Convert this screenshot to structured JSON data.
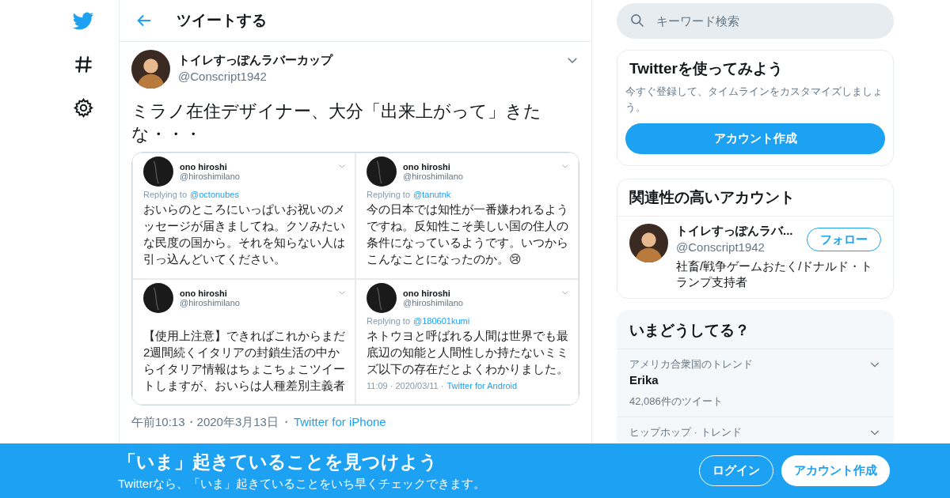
{
  "header": {
    "title": "ツイートする"
  },
  "tweet": {
    "author": {
      "name": "トイレすっぽんラバーカップ",
      "handle": "@Conscript1942"
    },
    "text": "ミラノ在住デザイナー、大分「出来上がって」きたな・・・",
    "embedded_screenshot": {
      "posts": [
        {
          "name": "ono hiroshi",
          "handle": "@hiroshimilano",
          "reply_prefix": "Replying to",
          "reply_to": "@octonubes",
          "text": "おいらのところにいっぱいお祝いのメッセージが届きましてね。クソみたいな民度の国から。それを知らない人は引っ込んどいてください。"
        },
        {
          "name": "ono hiroshi",
          "handle": "@hiroshimilano",
          "reply_prefix": "Replying to",
          "reply_to": "@tanutnk",
          "text": "今の日本では知性が一番嫌われるようですね。反知性こそ美しい国の住人の条件になっているようです。いつからこんなことになったのか。😢"
        },
        {
          "name": "ono hiroshi",
          "handle": "@hiroshimilano",
          "text": "【使用上注意】できればこれからまだ2週間続くイタリアの封鎖生活の中からイタリア情報はちょこちょこツイートしますが、おいらは人種差別主義者"
        },
        {
          "name": "ono hiroshi",
          "handle": "@hiroshimilano",
          "reply_prefix": "Replying to",
          "reply_to": "@180601kumi",
          "text": "ネトウヨと呼ばれる人間は世界でも最底辺の知能と人間性しか持たないミミズ以下の存在だとよくわかりました。",
          "footer": "11:09 · 2020/03/11 ·",
          "footer_source": "Twitter for Android"
        }
      ]
    },
    "date": "午前10:13・2020年3月13日",
    "separator": "・",
    "source": "Twitter for iPhone"
  },
  "search": {
    "placeholder": "キーワード検索"
  },
  "signup_card": {
    "title": "Twitterを使ってみよう",
    "text": "今すぐ登録して、タイムラインをカスタマイズしましょう。",
    "button": "アカウント作成"
  },
  "related_card": {
    "title": "関連性の高いアカウント",
    "accounts": [
      {
        "name": "トイレすっぽんラバ...",
        "handle": "@Conscript1942",
        "button": "フォロー",
        "bio": "社畜/戦争ゲームおたく/ドナルド・トランプ支持者"
      }
    ]
  },
  "trends_card": {
    "title": "いまどうしてる？",
    "trends": [
      {
        "context": "アメリカ合衆国のトレンド",
        "name": "Erika",
        "count": "42,086件のツイート"
      },
      {
        "context": "ヒップホップ · トレンド"
      }
    ]
  },
  "banner": {
    "title": "「いま」起きていることを見つけよう",
    "text": "Twitterなら、「いま」起きていることをいち早くチェックできます。",
    "buttons": [
      {
        "label": "ログイン",
        "kind": "outline"
      },
      {
        "label": "アカウント作成",
        "kind": "filled"
      }
    ]
  }
}
